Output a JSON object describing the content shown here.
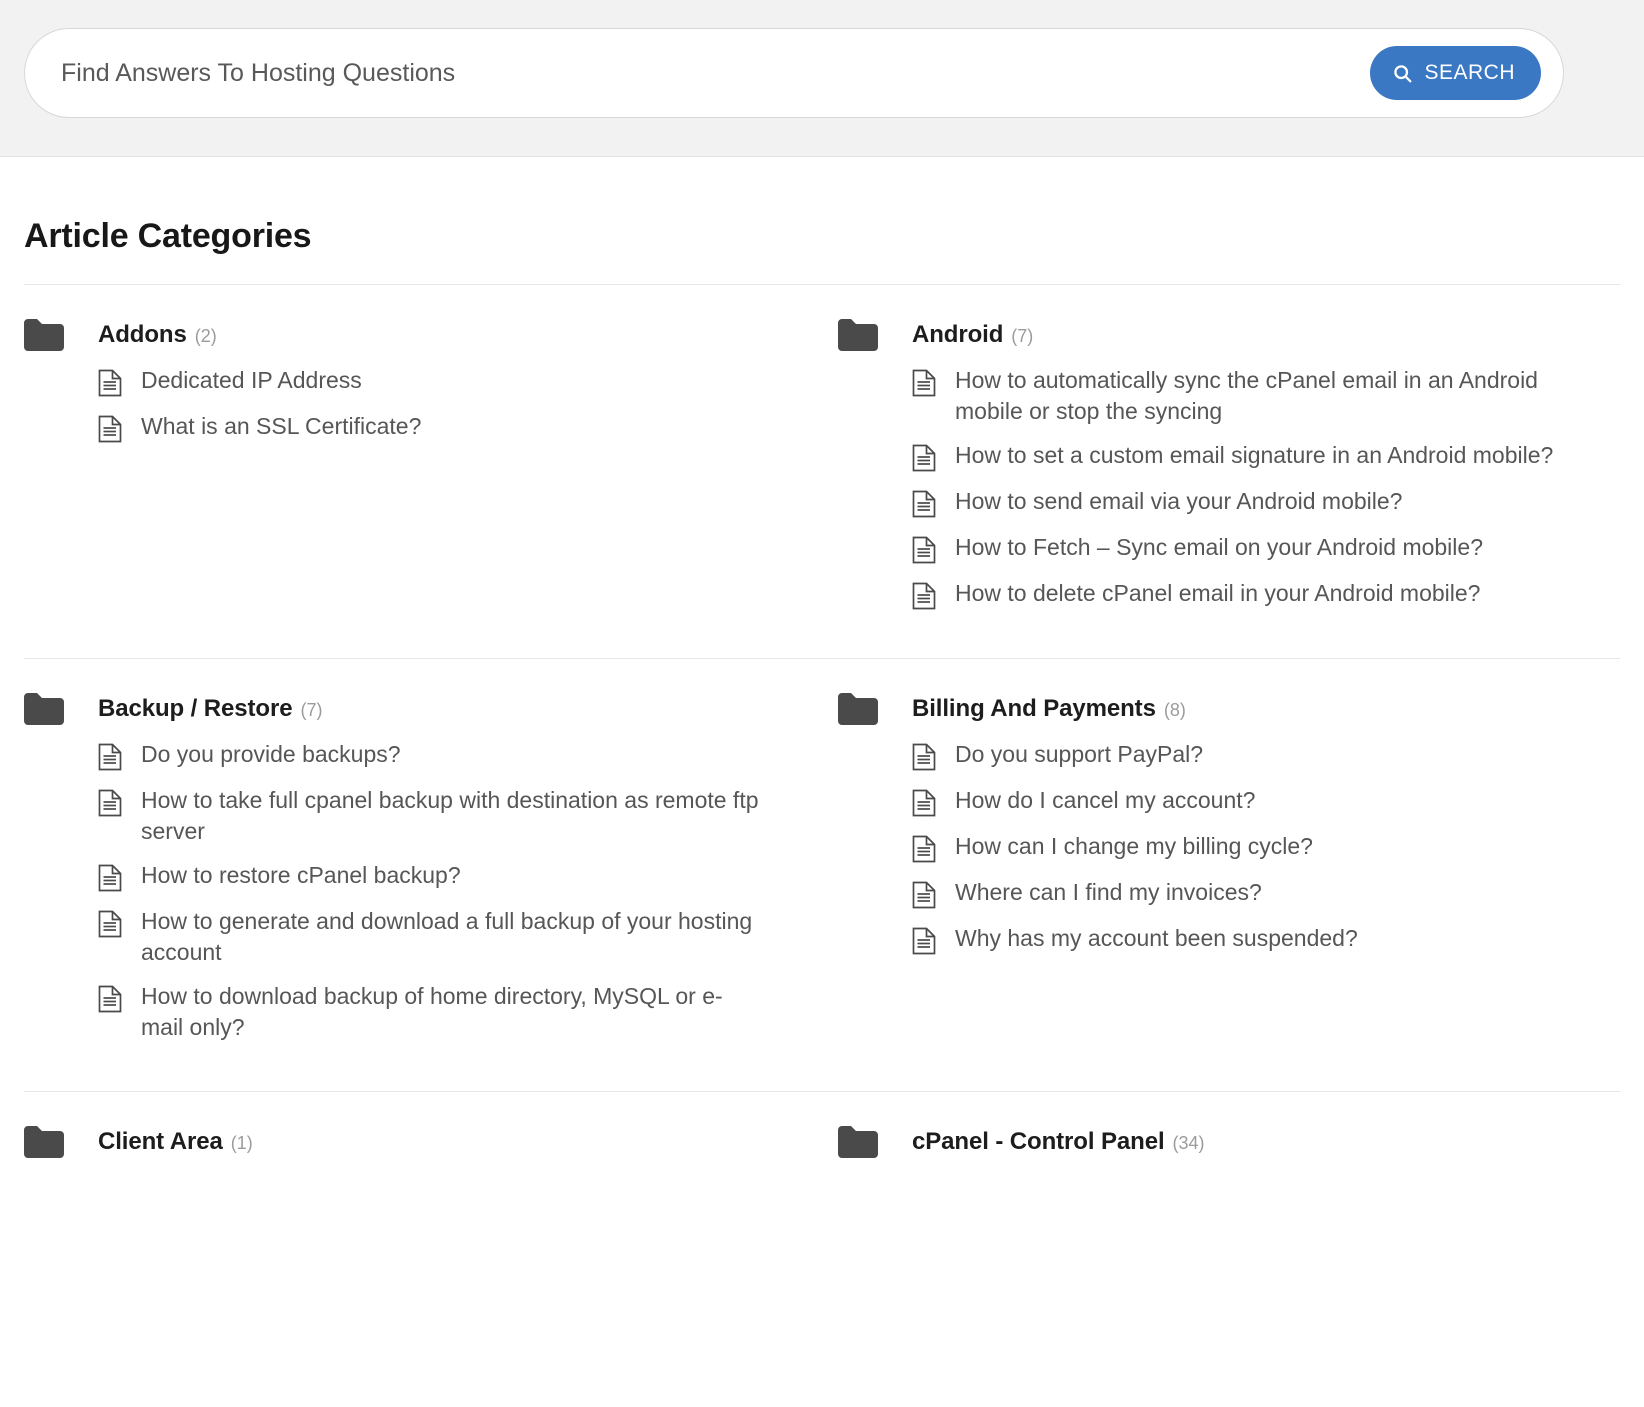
{
  "search": {
    "placeholder": "Find Answers To Hosting Questions",
    "value": "",
    "button_label": "SEARCH",
    "button_color": "#3b78c3",
    "icon": "search-icon"
  },
  "page": {
    "title": "Article Categories"
  },
  "icons": {
    "folder": "folder-icon",
    "document": "document-icon"
  },
  "categories": [
    {
      "name": "Addons",
      "count": "(2)",
      "articles": [
        "Dedicated IP Address",
        "What is an SSL Certificate?"
      ]
    },
    {
      "name": "Android",
      "count": "(7)",
      "articles": [
        "How to automatically sync the cPanel email in an Android mobile or stop the syncing",
        "How to set a custom email signature in an Android mobile?",
        "How to send email via your Android mobile?",
        "How to Fetch – Sync email on your Android mobile?",
        "How to delete cPanel email in your Android mobile?"
      ]
    },
    {
      "name": "Backup / Restore",
      "count": "(7)",
      "articles": [
        "Do you provide backups?",
        "How to take full cpanel backup with destination as remote ftp server",
        "How to restore cPanel backup?",
        "How to generate and download a full backup of your hosting account",
        "How to download backup of home directory, MySQL or e-mail only?"
      ]
    },
    {
      "name": "Billing And Payments",
      "count": "(8)",
      "articles": [
        "Do you support PayPal?",
        "How do I cancel my account?",
        "How can I change my billing cycle?",
        "Where can I find my invoices?",
        "Why has my account been suspended?"
      ]
    },
    {
      "name": "Client Area",
      "count": "(1)",
      "articles": []
    },
    {
      "name": "cPanel - Control Panel",
      "count": "(34)",
      "articles": []
    }
  ]
}
